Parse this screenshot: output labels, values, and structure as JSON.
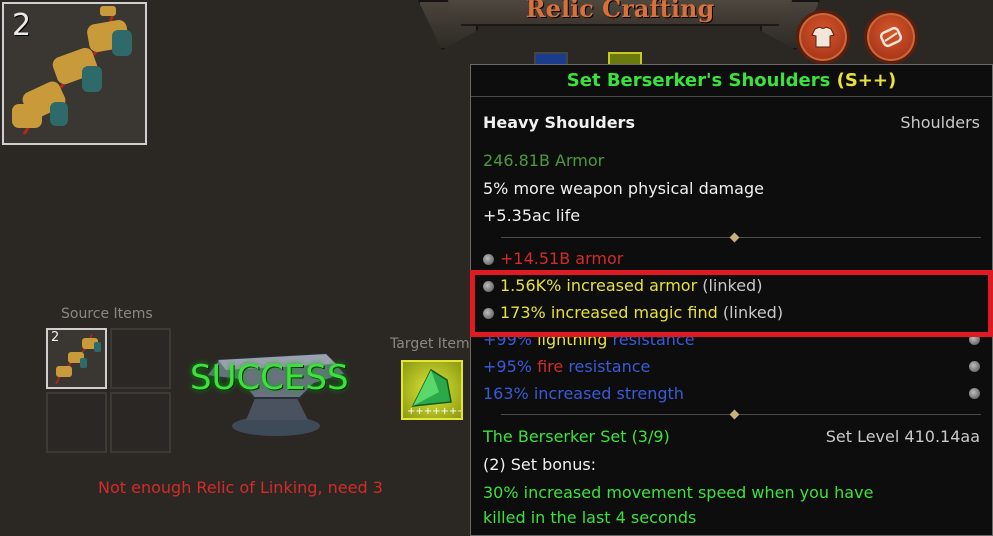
{
  "header": {
    "title": "Relic Crafting"
  },
  "relic": {
    "count": "2"
  },
  "source": {
    "label": "Source Items",
    "slot_count": "2"
  },
  "status": {
    "success": "SUCCESS",
    "error": "Not enough Relic of Linking, need 3"
  },
  "target": {
    "label": "Target Item"
  },
  "tooltip": {
    "name": "Set Berserker's Shoulders",
    "grade": "(S++)",
    "base_type": "Heavy Shoulders",
    "slot": "Shoulders",
    "armor": "246.81B Armor",
    "implicit_1": "5% more weapon physical damage",
    "implicit_2": "+5.35ac life",
    "mod_armor": "+14.51B armor",
    "mod_linked_1": "1.56K% increased armor",
    "mod_linked_2": "173% increased magic find",
    "linked_tag": "(linked)",
    "lightning_value": "+99%",
    "lightning_word": "lightning",
    "resistance_word": "resistance",
    "fire_value": "+95%",
    "fire_word": "fire",
    "strength": "163% increased strength",
    "set_name": "The Berserker Set (3/9)",
    "set_level": "Set Level 410.14aa",
    "set_bonus_header": "(2) Set bonus:",
    "set_bonus_line1": "30% increased movement speed when you have",
    "set_bonus_line2": "killed in the last 4 seconds"
  },
  "colors": {
    "highlight": "#e01a22",
    "set_green": "#3ce23c",
    "grade_yellow": "#e6e23a",
    "error_red": "#d42a2a"
  }
}
